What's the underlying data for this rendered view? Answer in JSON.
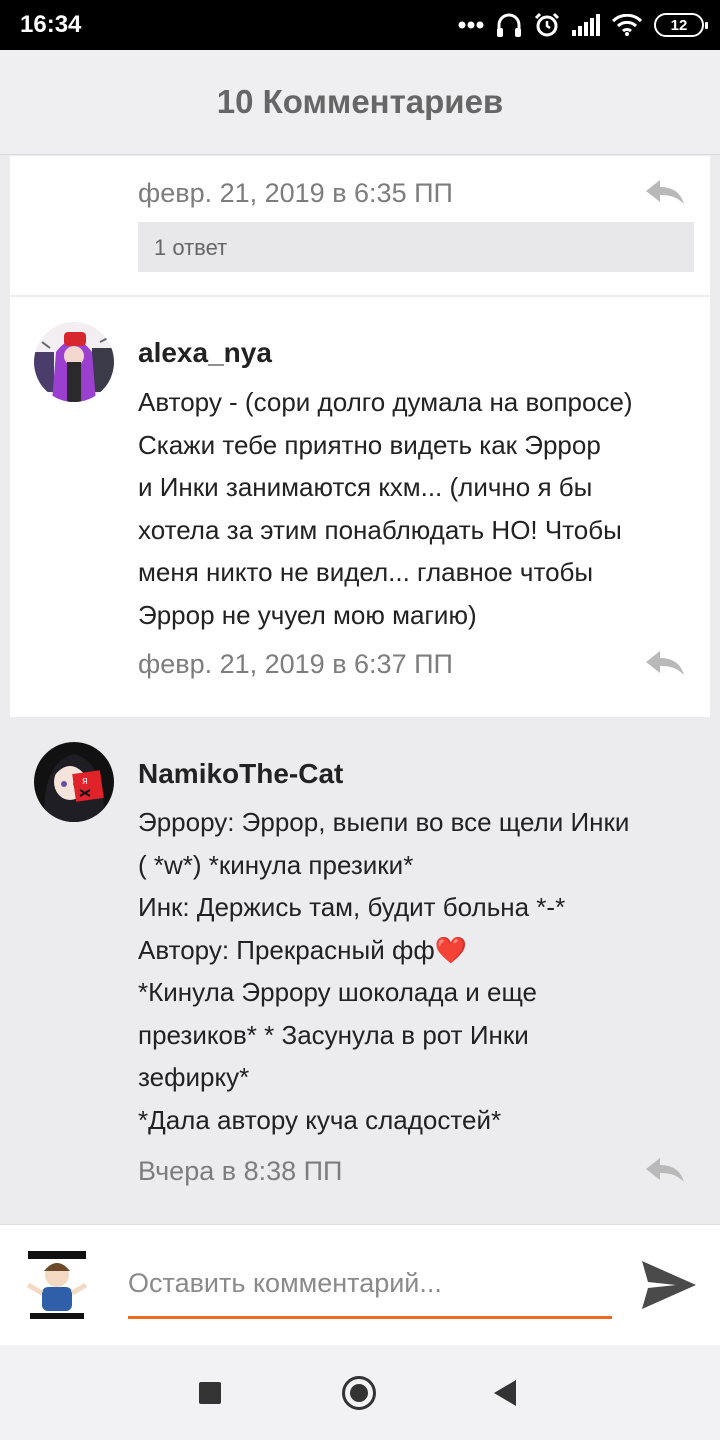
{
  "status_bar": {
    "time": "16:34",
    "battery": "12",
    "icons": [
      "more-dots-icon",
      "headphones-icon",
      "alarm-icon",
      "signal-icon",
      "wifi-icon",
      "battery-icon"
    ]
  },
  "header": {
    "title": "10 Комментариев"
  },
  "comments": [
    {
      "timestamp": "февр. 21, 2019 в 6:35 ПП",
      "reply_count": "1 ответ"
    },
    {
      "username": "alexa_nya",
      "lines": [
        "Автору - (сори долго думала на вопросе)",
        "Скажи тебе приятно видеть как Эррор",
        "и Инки занимаются кхм... (лично я бы",
        "хотела за этим понаблюдать НО! Чтобы",
        "меня никто не видел... главное чтобы",
        "Эррор не учуел мою магию)"
      ],
      "timestamp": "февр. 21, 2019 в 6:37 ПП"
    },
    {
      "username": "NamikoThe-Cat",
      "lines": [
        "Эррору: Эррор, выепи во все щели Инки",
        "( *w*)  *кинула презики*",
        "Инк: Держись там, будит больна *-*",
        "Автору: Прекрасный фф❤️",
        "*Кинула Эррору шоколада и еще",
        "презиков* * Засунула в рот Инки",
        "зефирку*",
        "*Дала автору куча сладостей*"
      ],
      "timestamp": "Вчера в 8:38 ПП"
    }
  ],
  "input": {
    "placeholder": "Оставить комментарий...",
    "value": ""
  },
  "colors": {
    "accent": "#f26a22",
    "header_bg": "#efeff1",
    "card_grey": "#ececee",
    "meta_text": "#7d7d7d"
  }
}
